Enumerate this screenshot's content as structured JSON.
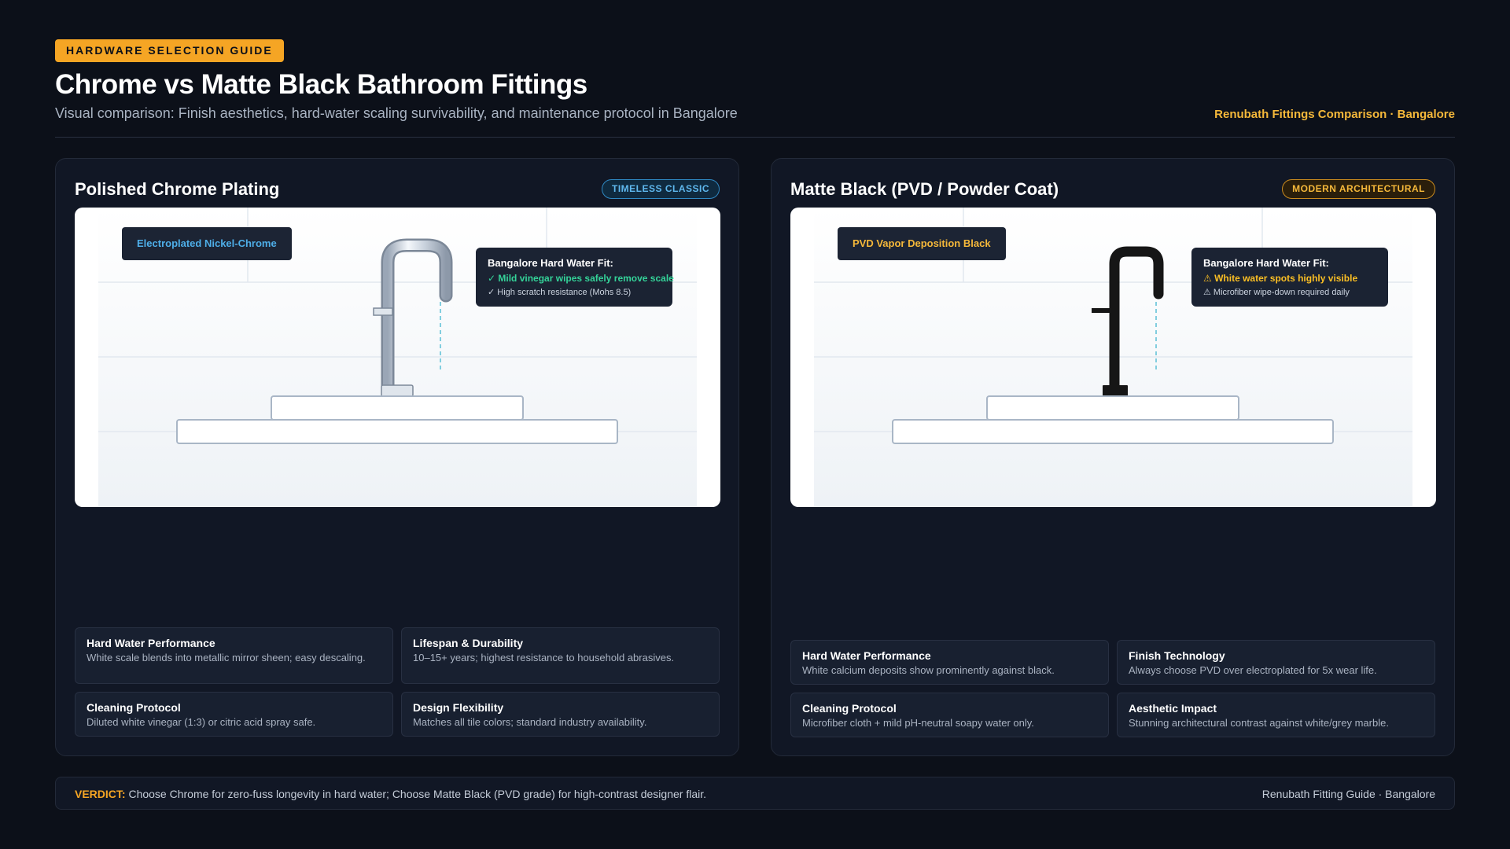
{
  "header": {
    "tag": "HARDWARE SELECTION GUIDE",
    "title": "Chrome vs Matte Black Bathroom Fittings",
    "subtitle": "Visual comparison: Finish aesthetics, hard-water scaling survivability, and maintenance protocol in Bangalore",
    "brand": "Renubath Fittings Comparison · Bangalore"
  },
  "chrome": {
    "title": "Polished Chrome Plating",
    "badge": "TIMELESS CLASSIC",
    "finish_label": "Electroplated Nickel-Chrome",
    "fit_title": "Bangalore Hard Water Fit:",
    "fit_line1": "✓ Mild vinegar wipes safely remove scale",
    "fit_line2": "✓ High scratch resistance (Mohs 8.5)",
    "cards": [
      {
        "title": "Hard Water Performance",
        "text": "White scale blends into metallic mirror sheen; easy descaling."
      },
      {
        "title": "Lifespan & Durability",
        "text": "10–15+ years; highest resistance to household abrasives."
      },
      {
        "title": "Cleaning Protocol",
        "text": "Diluted white vinegar (1:3) or citric acid spray safe."
      },
      {
        "title": "Design Flexibility",
        "text": "Matches all tile colors; standard industry availability."
      }
    ]
  },
  "black": {
    "title": "Matte Black (PVD / Powder Coat)",
    "badge": "MODERN ARCHITECTURAL",
    "finish_label": "PVD Vapor Deposition Black",
    "fit_title": "Bangalore Hard Water Fit:",
    "fit_line1": "⚠ White water spots highly visible",
    "fit_line2": "⚠ Microfiber wipe-down required daily",
    "cards": [
      {
        "title": "Hard Water Performance",
        "text": "White calcium deposits show prominently against black."
      },
      {
        "title": "Finish Technology",
        "text": "Always choose PVD over electroplated for 5x wear life."
      },
      {
        "title": "Cleaning Protocol",
        "text": "Microfiber cloth + mild pH-neutral soapy water only."
      },
      {
        "title": "Aesthetic Impact",
        "text": "Stunning architectural contrast against white/grey marble."
      }
    ]
  },
  "verdict": {
    "label": "VERDICT:",
    "text": " Choose Chrome for zero-fuss longevity in hard water; Choose Matte Black (PVD grade) for high-contrast designer flair.",
    "brand": "Renubath Fitting Guide · Bangalore"
  },
  "colors": {
    "accent": "#f5a524",
    "good": "#34d399",
    "warn": "#fbbf24",
    "chrome_blue": "#4eaee8"
  }
}
